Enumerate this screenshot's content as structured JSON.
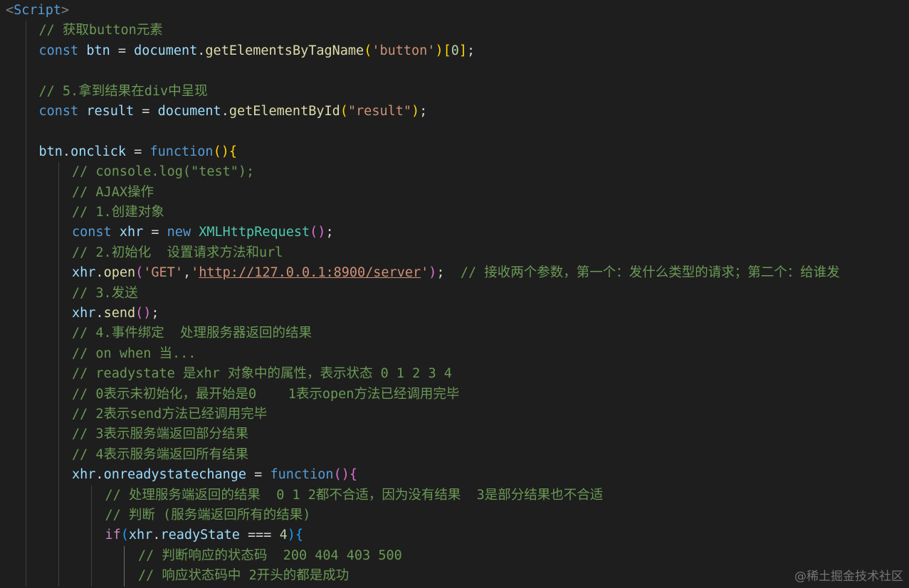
{
  "colors": {
    "background": "#1e1e1e",
    "tag": "#569cd6",
    "keyword": "#569cd6",
    "variable": "#9cdcfe",
    "function": "#dcdcaa",
    "string": "#ce9178",
    "comment": "#6a9955",
    "class": "#4ec9b0",
    "number": "#b5cea8",
    "bracket_gold": "#ffd700",
    "bracket_purple": "#da70d6",
    "bracket_blue": "#179fff",
    "plain": "#d4d4d4"
  },
  "watermark": "@稀土掘金技术社区",
  "lines": [
    {
      "indent": 0,
      "tokens": [
        [
          "<",
          "#808080"
        ],
        [
          "Script",
          "#569cd6"
        ],
        [
          ">",
          "#808080"
        ]
      ]
    },
    {
      "indent": 1,
      "tokens": [
        [
          "// 获取button元素",
          "#6a9955"
        ]
      ]
    },
    {
      "indent": 1,
      "tokens": [
        [
          "const ",
          "#569cd6"
        ],
        [
          "btn",
          "#9cdcfe"
        ],
        [
          " = ",
          "#d4d4d4"
        ],
        [
          "document",
          "#9cdcfe"
        ],
        [
          ".",
          "#d4d4d4"
        ],
        [
          "getElementsByTagName",
          "#dcdcaa"
        ],
        [
          "(",
          "#ffd700"
        ],
        [
          "'button'",
          "#ce9178"
        ],
        [
          ")",
          "#ffd700"
        ],
        [
          "[",
          "#ffd700"
        ],
        [
          "0",
          "#b5cea8"
        ],
        [
          "]",
          "#ffd700"
        ],
        [
          ";",
          "#d4d4d4"
        ]
      ]
    },
    {
      "indent": 1,
      "tokens": []
    },
    {
      "indent": 1,
      "tokens": [
        [
          "// 5.拿到结果在div中呈现",
          "#6a9955"
        ]
      ]
    },
    {
      "indent": 1,
      "tokens": [
        [
          "const ",
          "#569cd6"
        ],
        [
          "result",
          "#9cdcfe"
        ],
        [
          " = ",
          "#d4d4d4"
        ],
        [
          "document",
          "#9cdcfe"
        ],
        [
          ".",
          "#d4d4d4"
        ],
        [
          "getElementById",
          "#dcdcaa"
        ],
        [
          "(",
          "#ffd700"
        ],
        [
          "\"result\"",
          "#ce9178"
        ],
        [
          ")",
          "#ffd700"
        ],
        [
          ";",
          "#d4d4d4"
        ]
      ]
    },
    {
      "indent": 1,
      "tokens": []
    },
    {
      "indent": 1,
      "tokens": [
        [
          "btn",
          "#9cdcfe"
        ],
        [
          ".",
          "#d4d4d4"
        ],
        [
          "onclick",
          "#9cdcfe"
        ],
        [
          " = ",
          "#d4d4d4"
        ],
        [
          "function",
          "#569cd6"
        ],
        [
          "()",
          "#ffd700"
        ],
        [
          "{",
          "#ffd700"
        ]
      ]
    },
    {
      "indent": 2,
      "tokens": [
        [
          "// console.log(\"test\");",
          "#6a9955"
        ]
      ]
    },
    {
      "indent": 2,
      "tokens": [
        [
          "// AJAX操作",
          "#6a9955"
        ]
      ]
    },
    {
      "indent": 2,
      "tokens": [
        [
          "// 1.创建对象",
          "#6a9955"
        ]
      ]
    },
    {
      "indent": 2,
      "tokens": [
        [
          "const ",
          "#569cd6"
        ],
        [
          "xhr",
          "#9cdcfe"
        ],
        [
          " = ",
          "#d4d4d4"
        ],
        [
          "new ",
          "#569cd6"
        ],
        [
          "XMLHttpRequest",
          "#4ec9b0"
        ],
        [
          "()",
          "#da70d6"
        ],
        [
          ";",
          "#d4d4d4"
        ]
      ]
    },
    {
      "indent": 2,
      "tokens": [
        [
          "// 2.初始化  设置请求方法和url",
          "#6a9955"
        ]
      ]
    },
    {
      "indent": 2,
      "tokens": [
        [
          "xhr",
          "#9cdcfe"
        ],
        [
          ".",
          "#d4d4d4"
        ],
        [
          "open",
          "#dcdcaa"
        ],
        [
          "(",
          "#da70d6"
        ],
        [
          "'GET'",
          "#ce9178"
        ],
        [
          ",",
          "#d4d4d4"
        ],
        [
          "'",
          "#ce9178"
        ],
        [
          "http://127.0.0.1:8900/server",
          "#ce9178",
          "u"
        ],
        [
          "'",
          "#ce9178"
        ],
        [
          ")",
          "#da70d6"
        ],
        [
          ";  ",
          "#d4d4d4"
        ],
        [
          "// 接收两个参数，第一个：发什么类型的请求；第二个：给谁发",
          "#6a9955"
        ]
      ]
    },
    {
      "indent": 2,
      "tokens": [
        [
          "// 3.发送",
          "#6a9955"
        ]
      ]
    },
    {
      "indent": 2,
      "tokens": [
        [
          "xhr",
          "#9cdcfe"
        ],
        [
          ".",
          "#d4d4d4"
        ],
        [
          "send",
          "#dcdcaa"
        ],
        [
          "()",
          "#da70d6"
        ],
        [
          ";",
          "#d4d4d4"
        ]
      ]
    },
    {
      "indent": 2,
      "tokens": [
        [
          "// 4.事件绑定  处理服务器返回的结果",
          "#6a9955"
        ]
      ]
    },
    {
      "indent": 2,
      "tokens": [
        [
          "// on when 当...",
          "#6a9955"
        ]
      ]
    },
    {
      "indent": 2,
      "tokens": [
        [
          "// readystate 是xhr 对象中的属性，表示状态 0 1 2 3 4",
          "#6a9955"
        ]
      ]
    },
    {
      "indent": 2,
      "tokens": [
        [
          "// 0表示未初始化，最开始是0    1表示open方法已经调用完毕",
          "#6a9955"
        ]
      ]
    },
    {
      "indent": 2,
      "tokens": [
        [
          "// 2表示send方法已经调用完毕",
          "#6a9955"
        ]
      ]
    },
    {
      "indent": 2,
      "tokens": [
        [
          "// 3表示服务端返回部分结果",
          "#6a9955"
        ]
      ]
    },
    {
      "indent": 2,
      "tokens": [
        [
          "// 4表示服务端返回所有结果",
          "#6a9955"
        ]
      ]
    },
    {
      "indent": 2,
      "tokens": [
        [
          "xhr",
          "#9cdcfe"
        ],
        [
          ".",
          "#d4d4d4"
        ],
        [
          "onreadystatechange",
          "#9cdcfe"
        ],
        [
          " = ",
          "#d4d4d4"
        ],
        [
          "function",
          "#569cd6"
        ],
        [
          "()",
          "#da70d6"
        ],
        [
          "{",
          "#da70d6"
        ]
      ]
    },
    {
      "indent": 3,
      "tokens": [
        [
          "// 处理服务端返回的结果  0 1 2都不合适，因为没有结果  3是部分结果也不合适",
          "#6a9955"
        ]
      ]
    },
    {
      "indent": 3,
      "tokens": [
        [
          "// 判断 (服务端返回所有的结果)",
          "#6a9955"
        ]
      ]
    },
    {
      "indent": 3,
      "tokens": [
        [
          "if",
          "#c586c0"
        ],
        [
          "(",
          "#179fff"
        ],
        [
          "xhr",
          "#9cdcfe"
        ],
        [
          ".",
          "#d4d4d4"
        ],
        [
          "readyState",
          "#9cdcfe"
        ],
        [
          " === ",
          "#d4d4d4"
        ],
        [
          "4",
          "#b5cea8"
        ],
        [
          ")",
          "#179fff"
        ],
        [
          "{",
          "#179fff"
        ]
      ]
    },
    {
      "indent": 4,
      "tokens": [
        [
          "// 判断响应的状态码  200 404 403 500",
          "#6a9955"
        ]
      ]
    },
    {
      "indent": 4,
      "tokens": [
        [
          "// 响应状态码中 2开头的都是成功",
          "#6a9955"
        ]
      ]
    }
  ]
}
